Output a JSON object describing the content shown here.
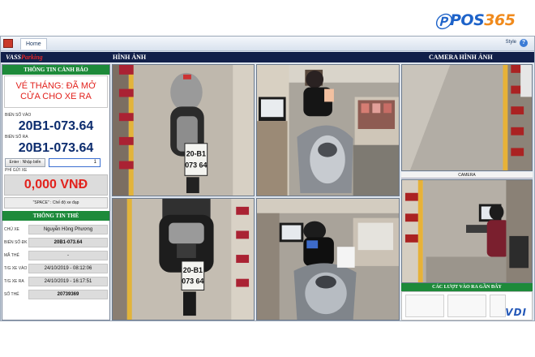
{
  "brand": {
    "mark": "Ⓟ",
    "name": "POS",
    "number": "365"
  },
  "window": {
    "tab_home": "Home",
    "style_label": "Style",
    "help_label": "?"
  },
  "header": {
    "logo_vass": "VASS",
    "logo_parking": "Parking",
    "title_images": "HÌNH ẢNH",
    "title_camera": "CAMERA HÌNH ẢNH"
  },
  "alert": {
    "heading": "THÔNG TIN CẢNH BÁO",
    "message": "VÉ THÁNG: ĐÃ MỞ CỬA CHO XE RA"
  },
  "plates": {
    "in_label": "BIỂN SỐ VÀO",
    "in_value": "20B1-073.64",
    "out_label": "BIỂN SỐ RA",
    "out_value": "20B1-073.64"
  },
  "entry": {
    "button_label": "Enter : Nhập biển",
    "input_value": "1"
  },
  "fee": {
    "label": "PHÍ GỬI XE",
    "value": "0,000 VNĐ"
  },
  "mode": {
    "text": "\"SPACE\" : Chế độ xe đạp"
  },
  "card": {
    "heading": "THÔNG TIN THẺ",
    "rows": [
      {
        "label": "CHỦ XE",
        "value": "Nguyễn Hồng Phương",
        "bold": false
      },
      {
        "label": "BIỂN SỐ ĐK",
        "value": "20B1-073.64",
        "bold": true
      },
      {
        "label": "MÃ THẺ",
        "value": "-",
        "bold": false
      },
      {
        "label": "T/G XE VÀO",
        "value": "24/10/2019 - 08:12:06",
        "bold": false
      },
      {
        "label": "T/G XE RA",
        "value": "24/10/2019 - 16:17:51",
        "bold": false
      },
      {
        "label": "SỐ THẺ",
        "value": "20739369",
        "bold": true
      }
    ]
  },
  "cameras": {
    "plate_top": [
      "20-B1",
      "073 64"
    ],
    "plate_bottom": [
      "20-B1",
      "073 64"
    ],
    "camera_label": "CAMERA",
    "recent_heading": "CÁC LƯỢT VÀO RA GẦN ĐÂY",
    "watermark": "VDI"
  },
  "colors": {
    "header_navy": "#12204a",
    "section_green": "#1d8a3a",
    "alert_red": "#e2221d",
    "plate_blue": "#0c2c6e",
    "brand_blue": "#1e63c9",
    "brand_orange": "#f08a1c"
  },
  "icons": {
    "app": "app-logo-icon",
    "help": "help-icon"
  }
}
